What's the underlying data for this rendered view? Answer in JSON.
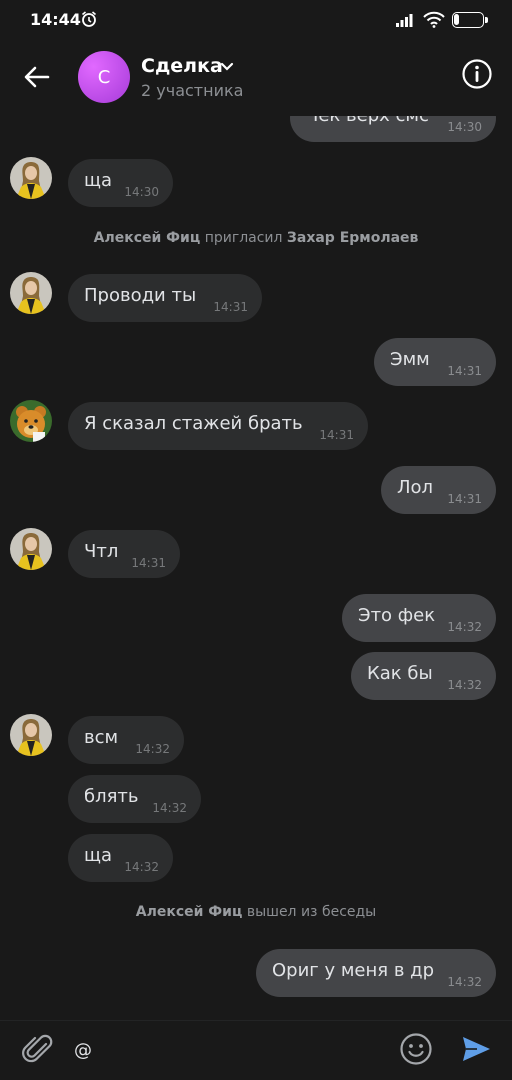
{
  "status_bar": {
    "time": "14:44",
    "battery": "17",
    "battery_level": 0.17
  },
  "header": {
    "title": "Сделка",
    "subtitle": "2 участника",
    "avatar_letter": "С"
  },
  "messages": {
    "m1": {
      "text": "Чек верх смс",
      "time": "14:30"
    },
    "m2": {
      "text": "ща",
      "time": "14:30"
    },
    "sys1": {
      "actor": "Алексей Фиц",
      "action": "пригласил",
      "target": "Захар Ермолаев"
    },
    "m3": {
      "text": "Проводи ты",
      "time": "14:31"
    },
    "m4": {
      "text": "Эмм",
      "time": "14:31"
    },
    "m5": {
      "text": "Я сказал стажей брать",
      "time": "14:31"
    },
    "m6": {
      "text": "Лол",
      "time": "14:31"
    },
    "m7": {
      "text": "Чтл",
      "time": "14:31"
    },
    "m8": {
      "text": "Это фек",
      "time": "14:32"
    },
    "m9": {
      "text": "Как бы",
      "time": "14:32"
    },
    "m10": {
      "text": "всм",
      "time": "14:32"
    },
    "m11": {
      "text": "блять",
      "time": "14:32"
    },
    "m12": {
      "text": "ща",
      "time": "14:32"
    },
    "sys2": {
      "actor": "Алексей Фиц",
      "action": "вышел из беседы"
    },
    "m13": {
      "text": "Ориг у меня в др",
      "time": "14:32"
    }
  },
  "composer": {
    "value": "@"
  },
  "colors": {
    "background": "#191919",
    "bubble_in": "#2c2d2e",
    "bubble_out": "#444548",
    "accent": "#5f9ee7",
    "avatar": "#c250f0"
  }
}
